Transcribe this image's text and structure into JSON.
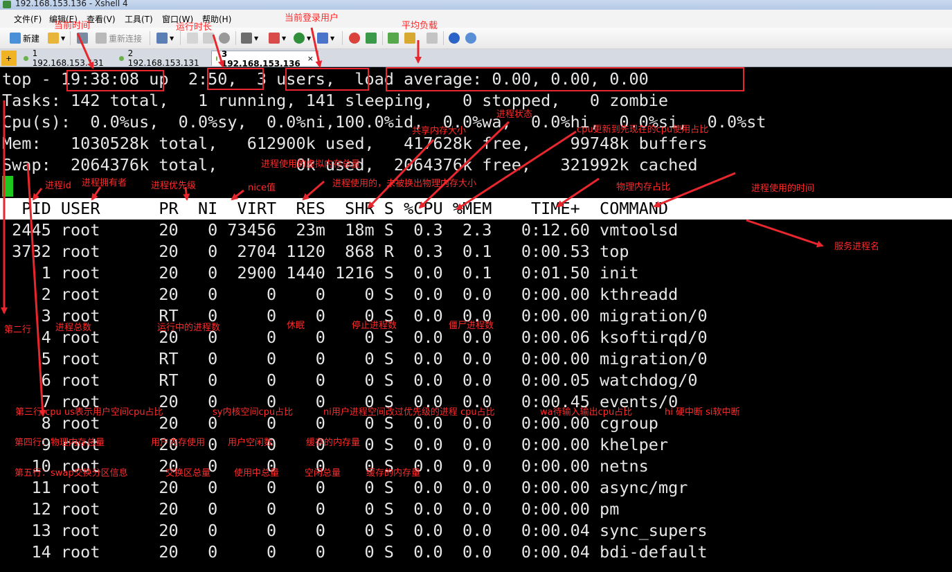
{
  "window": {
    "title": "192.168.153.136 - Xshell 4"
  },
  "menu": [
    "文件(F)",
    "编辑(E)",
    "查看(V)",
    "工具(T)",
    "窗口(W)",
    "帮助(H)"
  ],
  "toolbar": {
    "new_label": "新建",
    "reconnect_label": "重新连接"
  },
  "tabs": [
    {
      "label": "1 192.168.153.131",
      "active": false
    },
    {
      "label": "2 192.168.153.131",
      "active": false
    },
    {
      "label": "3 192.168.153.136",
      "active": true
    }
  ],
  "terminal": {
    "summary": [
      "top - 19:38:08 up  2:50,  3 users,  load average: 0.00, 0.00, 0.00",
      "Tasks: 142 total,   1 running, 141 sleeping,   0 stopped,   0 zombie",
      "Cpu(s):  0.0%us,  0.0%sy,  0.0%ni,100.0%id,  0.0%wa,  0.0%hi,  0.0%si,  0.0%st",
      "Mem:   1030528k total,   612900k used,   417628k free,    99748k buffers",
      "Swap:  2064376k total,        0k used,  2064376k free,   321992k cached"
    ],
    "header": "  PID USER      PR  NI  VIRT  RES  SHR S %CPU %MEM    TIME+  COMMAND",
    "processes": [
      " 2445 root      20   0 73456  23m  18m S  0.3  2.3   0:12.60 vmtoolsd",
      " 3732 root      20   0  2704 1120  868 R  0.3  0.1   0:00.53 top",
      "    1 root      20   0  2900 1440 1216 S  0.0  0.1   0:01.50 init",
      "    2 root      20   0     0    0    0 S  0.0  0.0   0:00.00 kthreadd",
      "    3 root      RT   0     0    0    0 S  0.0  0.0   0:00.00 migration/0",
      "    4 root      20   0     0    0    0 S  0.0  0.0   0:00.06 ksoftirqd/0",
      "    5 root      RT   0     0    0    0 S  0.0  0.0   0:00.00 migration/0",
      "    6 root      RT   0     0    0    0 S  0.0  0.0   0:00.05 watchdog/0",
      "    7 root      20   0     0    0    0 S  0.0  0.0   0:00.45 events/0",
      "    8 root      20   0     0    0    0 S  0.0  0.0   0:00.00 cgroup",
      "    9 root      20   0     0    0    0 S  0.0  0.0   0:00.00 khelper",
      "   10 root      20   0     0    0    0 S  0.0  0.0   0:00.00 netns",
      "   11 root      20   0     0    0    0 S  0.0  0.0   0:00.00 async/mgr",
      "   12 root      20   0     0    0    0 S  0.0  0.0   0:00.00 pm",
      "   13 root      20   0     0    0    0 S  0.0  0.0   0:00.04 sync_supers",
      "   14 root      20   0     0    0    0 S  0.0  0.0   0:00.04 bdi-default"
    ]
  },
  "annotations": {
    "current_time": "当前时间",
    "uptime": "运行时长",
    "current_users": "当前登录用户",
    "load_average": "平均负载",
    "process_state": "进程状态",
    "shared_mem": "共享内存大小",
    "cpu_share": "cpu更新到先现在的cpu使用占比",
    "virt_total": "进程使用的虚拟内存总量",
    "pid": "进程id",
    "owner": "进程拥有者",
    "priority": "进程优先级",
    "nice": "nice值",
    "res": "进程使用的，未被换出物理内存大小",
    "mem_share": "物理内存占比",
    "proc_time": "进程使用的时间",
    "service_name": "服务进程名",
    "line2": "第二行",
    "total_proc": "进程总数",
    "running_proc": "运行中的进程数",
    "sleep": "休眠",
    "stopped_proc": "停止进程数",
    "zombie_proc": "僵尸进程数",
    "line3_us": "第三行 cpu  us表示用户空间cpu占比",
    "line3_sy": "sy内核空间cpu占比",
    "line3_ni": "ni用户进程空间改过优先级的进程 cpu占比",
    "line3_wa": "wa待输入输出cpu占比",
    "line3_hi": "hi 硬中断 si软中断",
    "line4_total": "第四行：物理内存总量",
    "line4_used": "用户内存使用",
    "line4_free": "用户空闲数",
    "line4_buffers": "缓存的内存量",
    "line5_total": "第五行：swap交换分区信息",
    "line5_swap": "交换区总量",
    "line5_used": "使用中总量",
    "line5_free": "空闲总量",
    "line5_cached": "缓存的内存量"
  }
}
